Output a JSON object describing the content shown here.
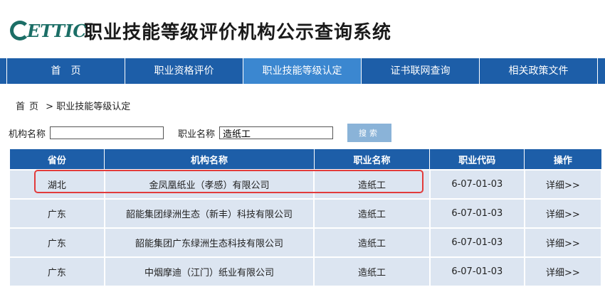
{
  "header": {
    "logo_text": "ETTIC",
    "title": "职业技能等级评价机构公示查询系统"
  },
  "nav": {
    "items": [
      {
        "label": "首　页"
      },
      {
        "label": "职业资格评价"
      },
      {
        "label": "职业技能等级认定"
      },
      {
        "label": "证书联网查询"
      },
      {
        "label": "相关政策文件"
      }
    ]
  },
  "breadcrumb": {
    "home": "首页",
    "separator": ">",
    "current": "职业技能等级认定"
  },
  "search": {
    "org_label": "机构名称",
    "org_value": "",
    "occupation_label": "职业名称",
    "occupation_value": "造纸工",
    "button_label": "搜索"
  },
  "table": {
    "headers": [
      "省份",
      "机构名称",
      "职业名称",
      "职业代码",
      "操作"
    ],
    "rows": [
      {
        "province": "湖北",
        "org": "金凤凰纸业（孝感）有限公司",
        "occupation": "造纸工",
        "code": "6-07-01-03",
        "action": "详细>>"
      },
      {
        "province": "广东",
        "org": "韶能集团绿洲生态（新丰）科技有限公司",
        "occupation": "造纸工",
        "code": "6-07-01-03",
        "action": "详细>>"
      },
      {
        "province": "广东",
        "org": "韶能集团广东绿洲生态科技有限公司",
        "occupation": "造纸工",
        "code": "6-07-01-03",
        "action": "详细>>"
      },
      {
        "province": "广东",
        "org": "中烟摩迪（江门）纸业有限公司",
        "occupation": "造纸工",
        "code": "6-07-01-03",
        "action": "详细>>"
      }
    ]
  },
  "colors": {
    "nav_bg": "#1d5ea8",
    "nav_active": "#3b87d0",
    "row_bg": "#dce5f1",
    "highlight": "#e23b3b",
    "logo": "#1b6e66"
  }
}
